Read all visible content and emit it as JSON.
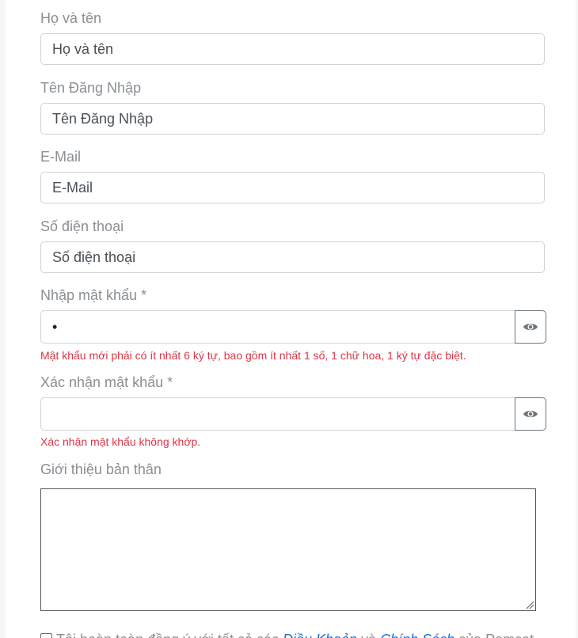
{
  "form": {
    "full_name": {
      "label": "Họ và tên",
      "placeholder": "Họ và tên",
      "value": ""
    },
    "username": {
      "label": "Tên Đăng Nhập",
      "placeholder": "Tên Đăng Nhập",
      "value": ""
    },
    "email": {
      "label": "E-Mail",
      "placeholder": "E-Mail",
      "value": ""
    },
    "phone": {
      "label": "Số điện thoại",
      "placeholder": "Số điện thoại",
      "value": ""
    },
    "password": {
      "label": "Nhập mật khẩu *",
      "masked_value": "•",
      "error": "Mật khẩu mới phải có ít nhất 6 ký tự, bao gồm ít nhất 1 số, 1 chữ hoa, 1 ký tự đặc biệt.",
      "toggle_icon": "eye-icon"
    },
    "confirm_password": {
      "label": "Xác nhận mật khẩu *",
      "masked_value": "",
      "error": "Xác nhận mật khẩu không khớp.",
      "toggle_icon": "eye-icon"
    },
    "bio": {
      "label": "Giới thiệu bản thân",
      "value": ""
    },
    "agree": {
      "text_before": "Tôi hoàn toàn đồng ý với tất cả các ",
      "terms_link": "Điều Khoản",
      "connector": " và ",
      "policy_link": "Chính Sách",
      "text_after": " của Pamcat",
      "checked": false
    }
  },
  "colors": {
    "error": "#dc3545",
    "link": "#1e6fd9",
    "label": "#8a8f94",
    "border": "#ced4da"
  }
}
